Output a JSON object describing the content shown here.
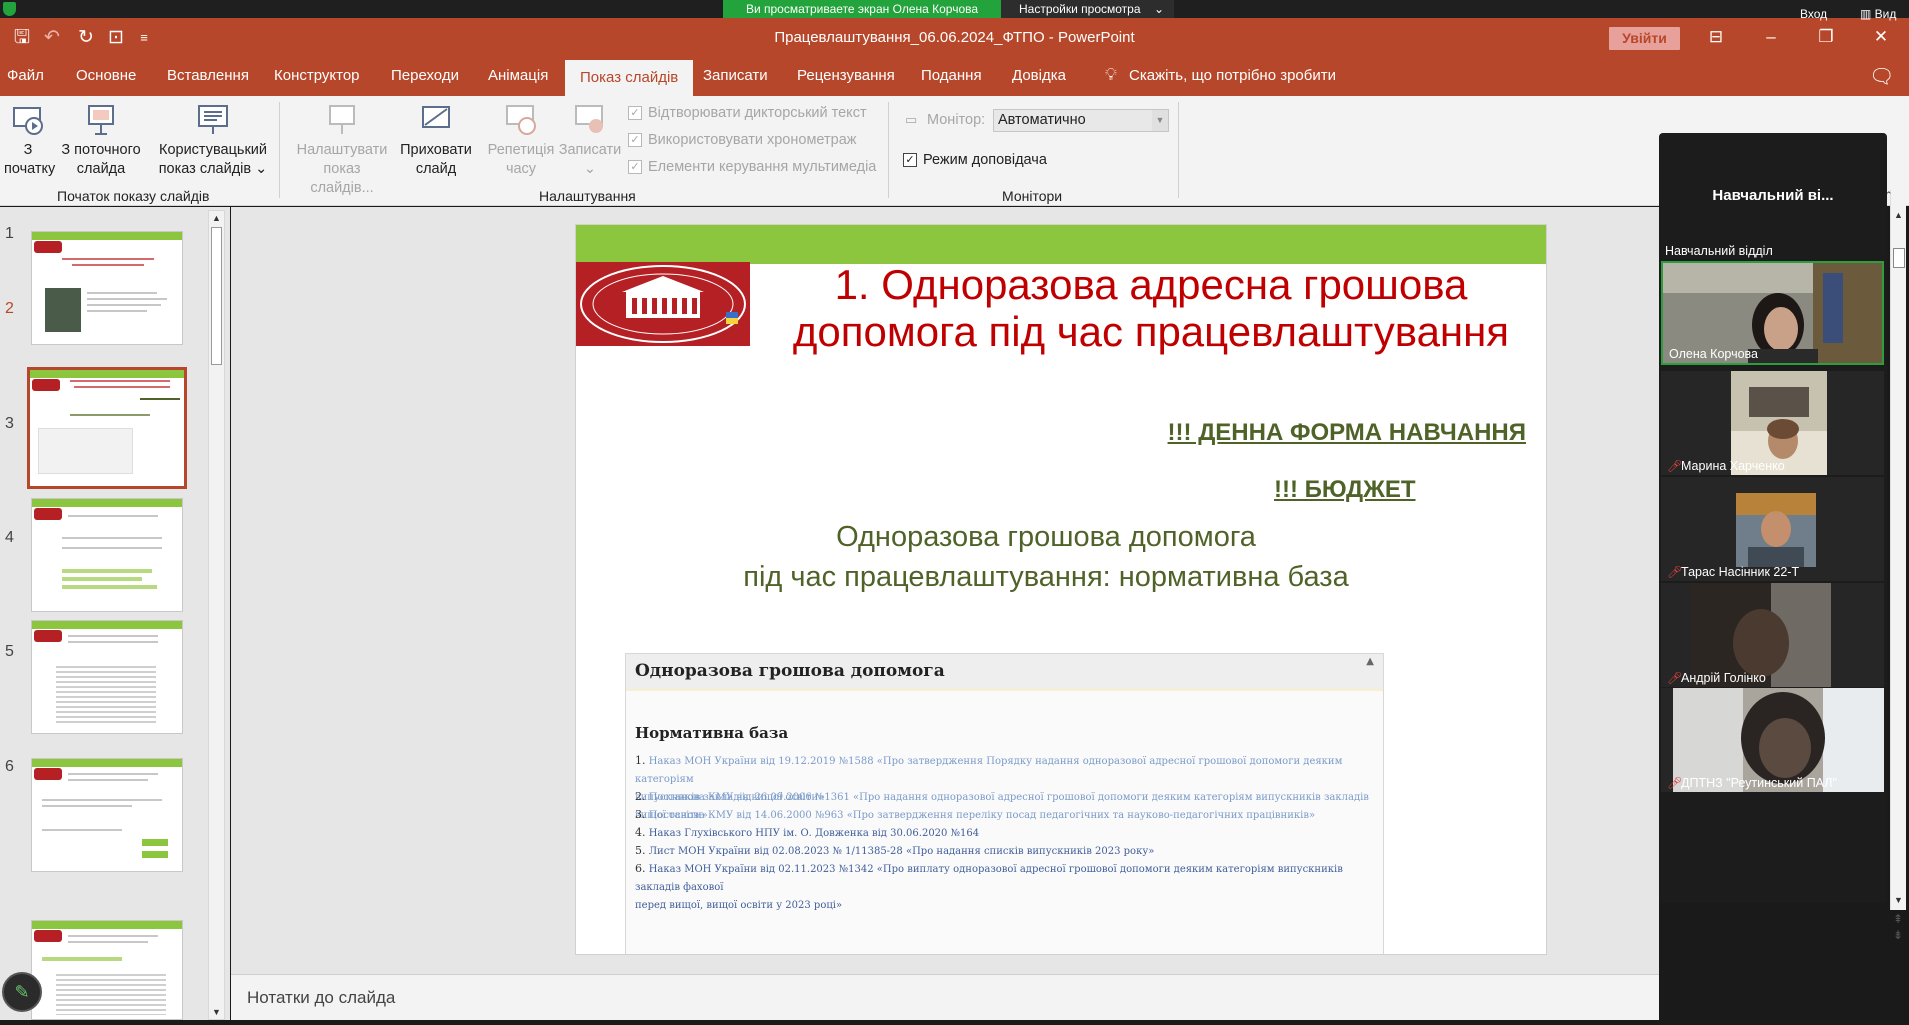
{
  "share_bar": {
    "banner": "Ви просматриваете экран Олена Корчова",
    "settings": "Настройки просмотра",
    "login": "Вход",
    "view": "Вид"
  },
  "titlebar": {
    "title": "Працевлаштування_06.06.2024_ФТПО  -  PowerPoint",
    "signin": "Увійти"
  },
  "tabs": [
    "Файл",
    "Основне",
    "Вставлення",
    "Конструктор",
    "Переходи",
    "Анімація",
    "Показ слайдів",
    "Записати",
    "Рецензування",
    "Подання",
    "Довідка"
  ],
  "active_tab": "Показ слайдів",
  "tell_me": "Скажіть, що потрібно зробити",
  "ribbon": {
    "start_group": {
      "label": "Початок показу слайдів",
      "from_beginning": [
        "З",
        "початку"
      ],
      "from_current": [
        "З поточного",
        "слайда"
      ],
      "custom_show": [
        "Користувацький",
        "показ слайдів ⌄"
      ]
    },
    "setup_group": {
      "label": "Налаштування",
      "setup_show": [
        "Налаштувати",
        "показ слайдів..."
      ],
      "hide_slide": [
        "Приховати",
        "слайд"
      ],
      "rehearse": [
        "Репетиція",
        "часу"
      ],
      "record": [
        "Записати",
        "⌄"
      ],
      "play_narrations": "Відтворювати дикторський текст",
      "use_timings": "Використовувати хронометраж",
      "media_controls": "Елементи керування мультимедіа"
    },
    "monitors_group": {
      "label": "Монітори",
      "monitor_label": "Монітор:",
      "monitor_value": "Автоматично",
      "presenter_view": "Режим доповідача"
    }
  },
  "thumbnails": [
    "1",
    "2",
    "3",
    "4",
    "5",
    "6"
  ],
  "selected_slide": "2",
  "slide": {
    "title": "1. Одноразова адресна грошова допомога під час працевлаштування",
    "daily_form": "!!! ДЕННА ФОРМА НАВЧАННЯ",
    "budget": "!!! БЮДЖЕТ",
    "subtitle_1": "Одноразова грошова допомога",
    "subtitle_2": "під час працевлаштування: нормативна база",
    "doc_heading": "Одноразова грошова допомога",
    "doc_sub": "Нормативна база",
    "refs": [
      {
        "n": "1.",
        "text": "Наказ МОН України від 19.12.2019 №1588 «Про затвердження Порядку надання одноразової адресної грошової допомоги деяким категоріям",
        "cont": "випускників закладів вищої освіти»"
      },
      {
        "n": "2.",
        "text": "Постанова КМУ від 26.09.2006 №1361 «Про надання одноразової адресної грошової допомоги деяким категоріям випускників закладів вищої освіти»"
      },
      {
        "n": "3.",
        "text": "Постанова КМУ від 14.06.2000 №963 «Про затвердження переліку посад педагогічних та науково-педагогічних працівників»"
      },
      {
        "n": "4.",
        "text": "Наказ Глухівського НПУ ім. О. Довженка від 30.06.2020 №164"
      },
      {
        "n": "5.",
        "text": "Лист МОН України від 02.08.2023 № 1/11385-28 «Про надання списків випускників 2023 року»"
      },
      {
        "n": "6.",
        "text": "Наказ МОН України від 02.11.2023 №1342 «Про виплату одноразової адресної грошової  допомоги деяким категоріям випускників закладів фахової",
        "cont": "перед вищої, вищої освіти у 2023 році»"
      }
    ]
  },
  "notes_label": "Нотатки до слайда",
  "participants": {
    "header": "Навчальний ві...",
    "label": "Навчальний відділ",
    "people": [
      {
        "name": "Олена Корчова",
        "muted": false
      },
      {
        "name": "Марина Харченко",
        "muted": true
      },
      {
        "name": "Тарас Насінник 22-Т",
        "muted": true
      },
      {
        "name": "Андрій Голінко",
        "muted": true
      },
      {
        "name": "ДПТНЗ \"Реутинський ПАЛ\"",
        "muted": true
      }
    ]
  },
  "colors": {
    "accent": "#b7472a",
    "slide_green": "#8cc63f",
    "slide_red": "#c00000",
    "olive": "#4f6228"
  }
}
